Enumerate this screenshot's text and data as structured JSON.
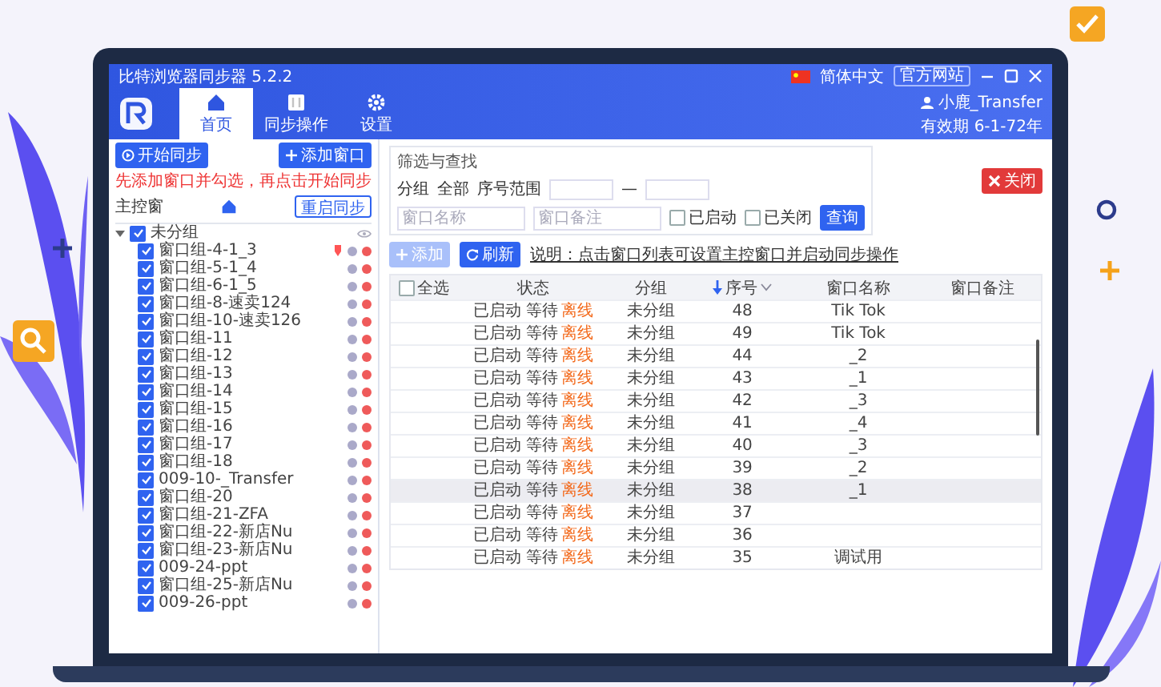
{
  "window": {
    "title": "比特浏览器同步器 5.2.2"
  },
  "titlebar": {
    "language": "简体中文",
    "website_button": "官方网站"
  },
  "nav": {
    "tabs": [
      {
        "label": "首页",
        "selected": true
      },
      {
        "label": "同步操作",
        "selected": false
      },
      {
        "label": "设置",
        "selected": false
      }
    ],
    "user": {
      "name": "小鹿_Transfer",
      "expiry": "有效期 6-1-72年"
    }
  },
  "left": {
    "start_button": "开始同步",
    "add_button": "添加窗口",
    "hint": "先添加窗口并勾选，再点击开始同步",
    "master_label": "主控窗",
    "restart_button": "重启同步",
    "tree": {
      "label": "未分组",
      "expanded": true,
      "checked": true,
      "children": [
        {
          "label": "窗口组-4-1_3",
          "checked": true,
          "pinned": true
        },
        {
          "label": "窗口组-5-1_4",
          "checked": true,
          "pinned": false
        },
        {
          "label": "窗口组-6-1_5",
          "checked": true,
          "pinned": false
        },
        {
          "label": "窗口组-8-速卖124",
          "checked": true,
          "pinned": false
        },
        {
          "label": "窗口组-10-速卖126",
          "checked": true,
          "pinned": false
        },
        {
          "label": "窗口组-11",
          "checked": true,
          "pinned": false
        },
        {
          "label": "窗口组-12",
          "checked": true,
          "pinned": false
        },
        {
          "label": "窗口组-13",
          "checked": true,
          "pinned": false
        },
        {
          "label": "窗口组-14",
          "checked": true,
          "pinned": false
        },
        {
          "label": "窗口组-15",
          "checked": true,
          "pinned": false
        },
        {
          "label": "窗口组-16",
          "checked": true,
          "pinned": false
        },
        {
          "label": "窗口组-17",
          "checked": true,
          "pinned": false
        },
        {
          "label": "窗口组-18",
          "checked": true,
          "pinned": false
        },
        {
          "label": "009-10-_Transfer",
          "checked": true,
          "pinned": false
        },
        {
          "label": "窗口组-20",
          "checked": true,
          "pinned": false
        },
        {
          "label": "窗口组-21-ZFA",
          "checked": true,
          "pinned": false
        },
        {
          "label": "窗口组-22-新店Nu",
          "checked": true,
          "pinned": false
        },
        {
          "label": "窗口组-23-新店Nu",
          "checked": true,
          "pinned": false
        },
        {
          "label": "009-24-ppt",
          "checked": true,
          "pinned": false
        },
        {
          "label": "窗口组-25-新店Nu",
          "checked": true,
          "pinned": false
        },
        {
          "label": "009-26-ppt",
          "checked": true,
          "pinned": false
        }
      ]
    }
  },
  "filter": {
    "title": "筛选与查找",
    "group_label": "分组",
    "group_value": "全部",
    "range_label": "序号范围",
    "range_separator": "—",
    "name_placeholder": "窗口名称",
    "note_placeholder": "窗口备注",
    "checks": [
      {
        "label": "已启动",
        "checked": false
      },
      {
        "label": "已关闭",
        "checked": false
      }
    ],
    "query_button": "查询"
  },
  "close_button": "关闭",
  "toolbar": {
    "add_button": {
      "label": "添加",
      "disabled": true
    },
    "refresh_button": "刷新",
    "note": "说明：点击窗口列表可设置主控窗口并启动同步操作"
  },
  "table": {
    "select_all": {
      "label": "全选",
      "checked": false
    },
    "columns": [
      {
        "label": "状态",
        "sorted": false
      },
      {
        "label": "分组",
        "sorted": false
      },
      {
        "label": "序号",
        "sorted": true
      },
      {
        "label": "窗口名称",
        "sorted": false
      },
      {
        "label": "窗口备注",
        "sorted": false
      }
    ],
    "rows": [
      {
        "status": "已启动 等待",
        "badge": "离线",
        "group": "未分组",
        "index": "48",
        "name": "Tik Tok",
        "selected": false
      },
      {
        "status": "已启动 等待",
        "badge": "离线",
        "group": "未分组",
        "index": "49",
        "name": "Tik Tok",
        "selected": false
      },
      {
        "status": "已启动 等待",
        "badge": "离线",
        "group": "未分组",
        "index": "44",
        "name": "_2",
        "selected": false
      },
      {
        "status": "已启动 等待",
        "badge": "离线",
        "group": "未分组",
        "index": "43",
        "name": "_1",
        "selected": false
      },
      {
        "status": "已启动 等待",
        "badge": "离线",
        "group": "未分组",
        "index": "42",
        "name": "_3",
        "selected": false
      },
      {
        "status": "已启动 等待",
        "badge": "离线",
        "group": "未分组",
        "index": "41",
        "name": "_4",
        "selected": false
      },
      {
        "status": "已启动 等待",
        "badge": "离线",
        "group": "未分组",
        "index": "40",
        "name": "_3",
        "selected": false
      },
      {
        "status": "已启动 等待",
        "badge": "离线",
        "group": "未分组",
        "index": "39",
        "name": "_2",
        "selected": false
      },
      {
        "status": "已启动 等待",
        "badge": "离线",
        "group": "未分组",
        "index": "38",
        "name": "_1",
        "selected": true
      },
      {
        "status": "已启动 等待",
        "badge": "离线",
        "group": "未分组",
        "index": "37",
        "selected": false
      },
      {
        "status": "已启动 等待",
        "badge": "离线",
        "group": "未分组",
        "index": "36",
        "selected": false
      },
      {
        "status": "已启动 等待",
        "badge": "离线",
        "group": "未分组",
        "index": "35",
        "name": "调试用",
        "selected": false
      }
    ]
  }
}
